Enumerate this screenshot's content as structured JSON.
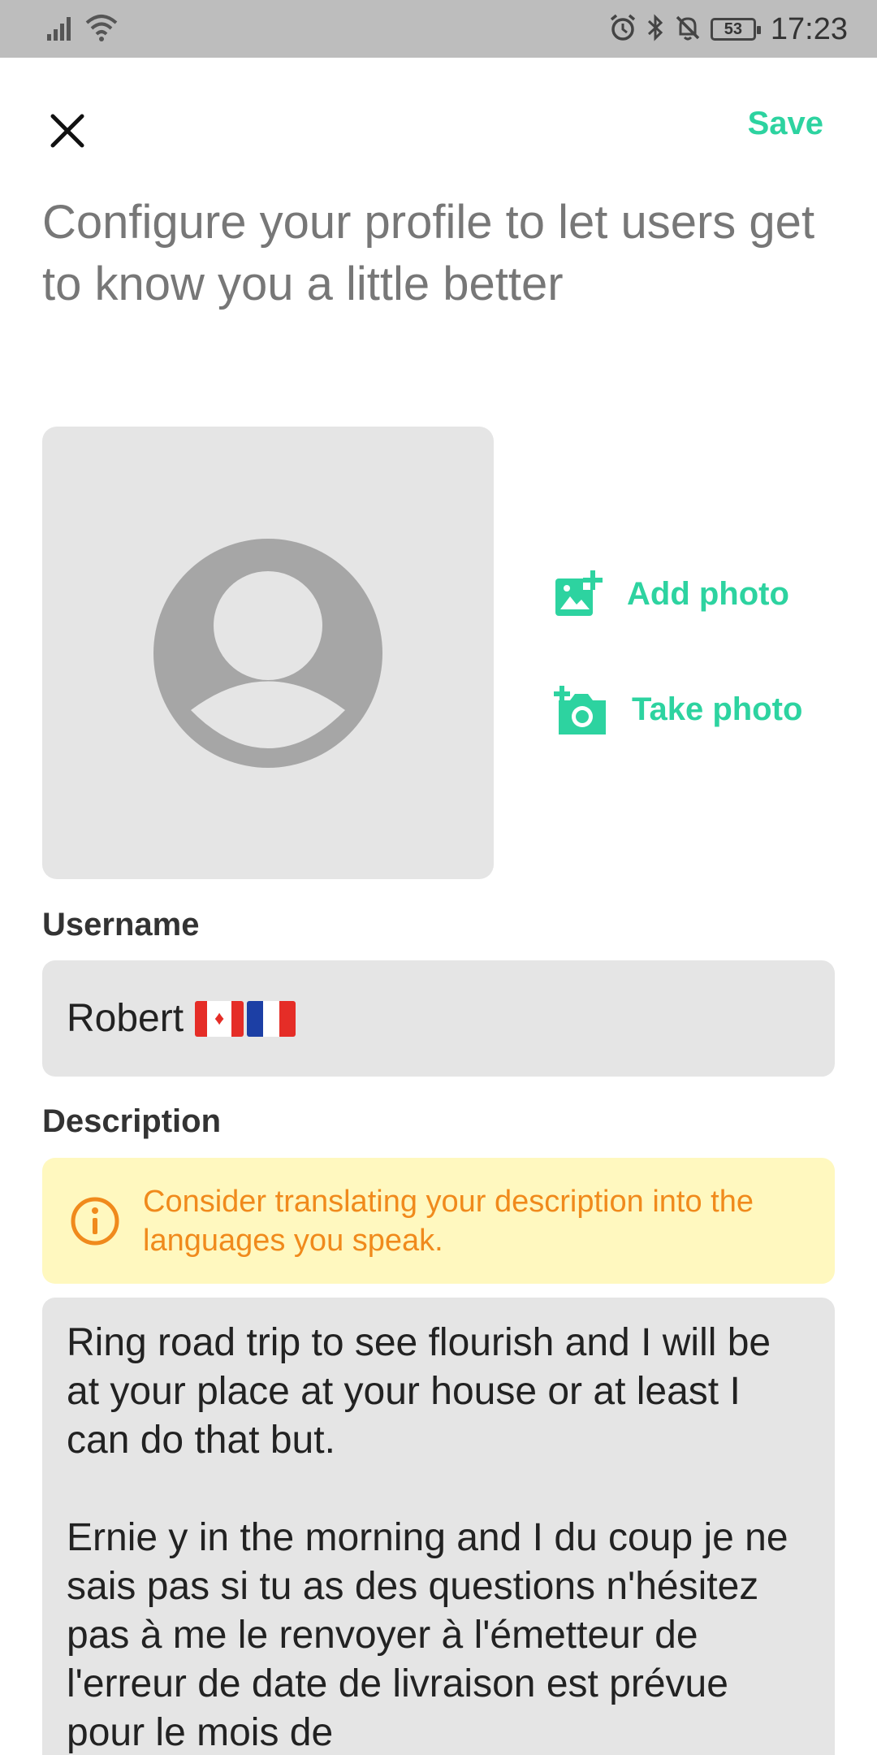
{
  "status_bar": {
    "time": "17:23",
    "battery": "53",
    "icons": [
      "signal-icon",
      "wifi-icon",
      "alarm-icon",
      "bluetooth-icon",
      "mute-icon",
      "battery-icon"
    ]
  },
  "header": {
    "close_icon": "close-icon",
    "save_label": "Save"
  },
  "page_title": "Configure your profile to let users get to know you a little better",
  "photo_actions": {
    "add_label": "Add photo",
    "take_label": "Take photo"
  },
  "username": {
    "label": "Username",
    "value": "Robert"
  },
  "description": {
    "label": "Description",
    "notice": "Consider translating your description into the languages you speak.",
    "paragraph_1": "Ring road trip to see flourish and I will be at your place at your house or at least I can do that but.",
    "paragraph_2": "Ernie y in the morning and I du coup je ne sais pas si tu as des questions n'hésitez pas à me le renvoyer à l'émetteur de l'erreur de date de livraison est prévue pour le mois de"
  },
  "colors": {
    "accent": "#2dd3a0",
    "notice_bg": "#fff8bf",
    "notice_text": "#f08a1c",
    "field_bg": "#e5e5e5"
  }
}
